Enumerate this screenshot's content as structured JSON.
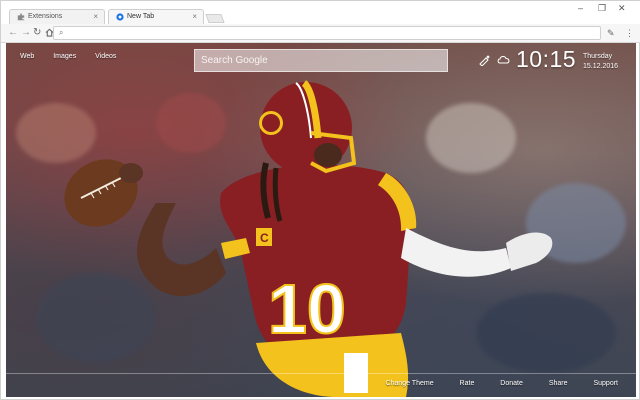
{
  "tabs": [
    {
      "label": "Extensions",
      "active": false
    },
    {
      "label": "New Tab",
      "active": true
    }
  ],
  "omnibox": {
    "value": ""
  },
  "newtab": {
    "nav": {
      "web": "Web",
      "images": "Images",
      "videos": "Videos"
    },
    "search": {
      "placeholder": "Search Google"
    },
    "clock": {
      "time": "10:15",
      "day": "Thursday",
      "date": "15.12.2016"
    },
    "jersey_number": "10",
    "footer": {
      "change_theme": "Change Theme",
      "rate": "Rate",
      "donate": "Donate",
      "share": "Share",
      "support": "Support"
    }
  },
  "colors": {
    "jersey": "#8a1f23",
    "gold": "#f3c21c",
    "accent_tab": "#1a73e8"
  }
}
